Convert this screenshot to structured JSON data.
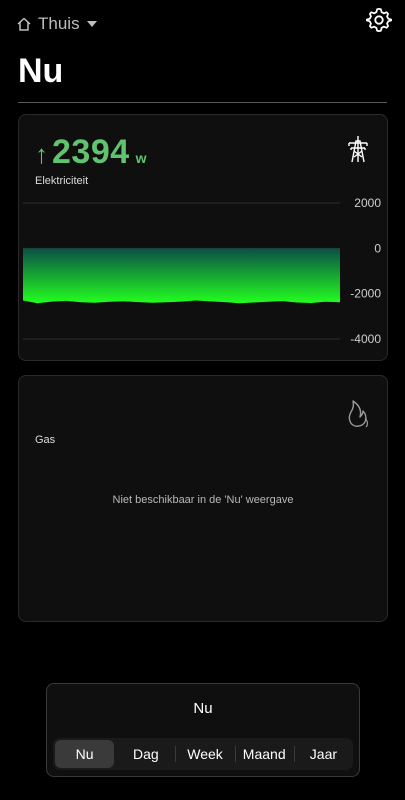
{
  "header": {
    "location": "Thuis",
    "title": "Nu"
  },
  "electricity": {
    "value": "2394",
    "unit": "w",
    "direction": "up",
    "label": "Elektriciteit",
    "color": "#5fc36f"
  },
  "chart_data": {
    "type": "area",
    "yticks": [
      2000,
      0,
      -2000,
      -4000
    ],
    "ylim": [
      -4000,
      2000
    ],
    "grid": true,
    "series": [
      {
        "values": [
          -2300,
          -2420,
          -2350,
          -2320,
          -2380,
          -2400,
          -2360,
          -2340,
          -2370,
          -2400,
          -2380,
          -2350,
          -2300,
          -2340,
          -2370,
          -2420,
          -2390,
          -2360,
          -2330,
          -2390,
          -2410,
          -2360,
          -2380
        ]
      }
    ],
    "colors": {
      "fill_top": "#0b4f45",
      "fill_bottom": "#22ff1f"
    }
  },
  "gas": {
    "label": "Gas",
    "notice": "Niet beschikbaar in de 'Nu' weergave"
  },
  "period": {
    "title": "Nu",
    "options": [
      "Nu",
      "Dag",
      "Week",
      "Maand",
      "Jaar"
    ],
    "selected": "Nu"
  }
}
